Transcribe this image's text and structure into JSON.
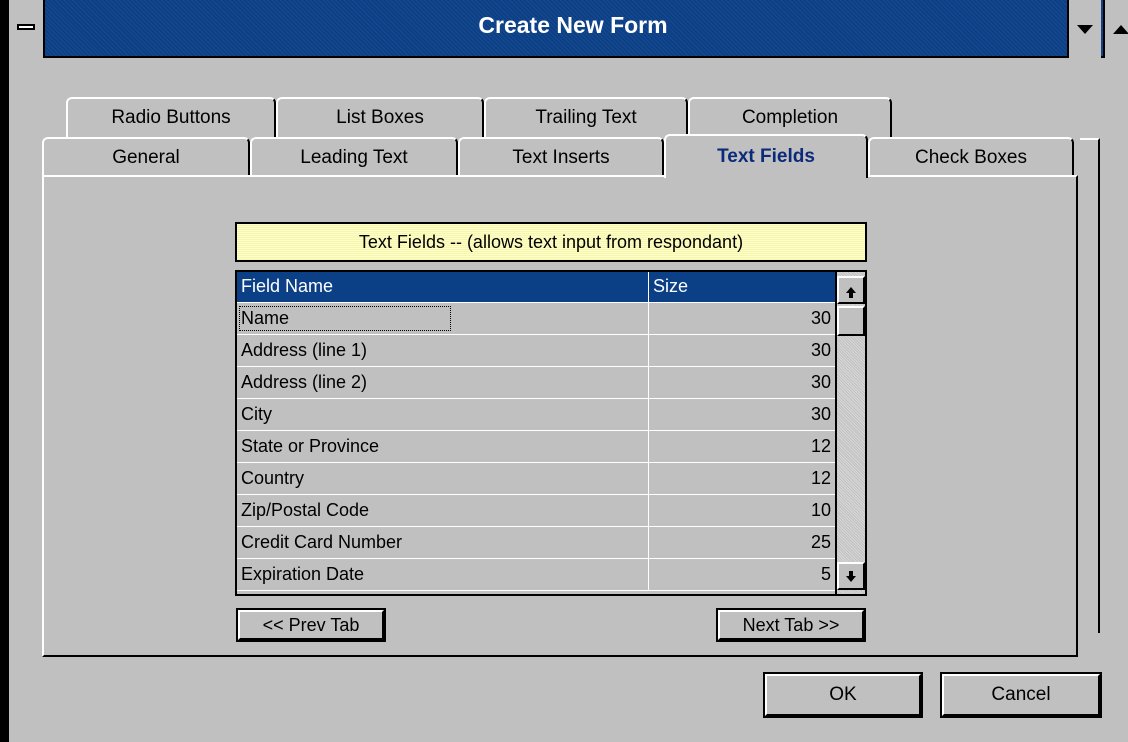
{
  "window": {
    "title": "Create New Form"
  },
  "tabs": {
    "back_row": [
      {
        "label": "Radio Buttons"
      },
      {
        "label": "List Boxes"
      },
      {
        "label": "Trailing Text"
      },
      {
        "label": "Completion"
      }
    ],
    "front_row": [
      {
        "label": "General"
      },
      {
        "label": "Leading Text"
      },
      {
        "label": "Text Inserts"
      },
      {
        "label": "Text Fields",
        "active": true
      },
      {
        "label": "Check Boxes"
      }
    ]
  },
  "panel": {
    "banner": "Text Fields -- (allows text input from respondant)",
    "grid": {
      "headers": [
        "Field Name",
        "Size"
      ],
      "rows": [
        {
          "name": "Name",
          "size": "30"
        },
        {
          "name": "Address (line 1)",
          "size": "30"
        },
        {
          "name": "Address (line 2)",
          "size": "30"
        },
        {
          "name": "City",
          "size": "30"
        },
        {
          "name": "State or Province",
          "size": "12"
        },
        {
          "name": "Country",
          "size": "12"
        },
        {
          "name": "Zip/Postal Code",
          "size": "10"
        },
        {
          "name": "Credit Card Number",
          "size": "25"
        },
        {
          "name": "Expiration Date",
          "size": "5"
        }
      ],
      "selected_row": 0
    },
    "prev_tab_label": "<< Prev Tab",
    "next_tab_label": "Next Tab >>"
  },
  "dialog": {
    "ok_label": "OK",
    "cancel_label": "Cancel"
  },
  "colors": {
    "title_bar": "#0b3f86",
    "face": "#c0c0c0",
    "banner": "#ffffc0",
    "active_tab_text": "#0b2a7a"
  }
}
